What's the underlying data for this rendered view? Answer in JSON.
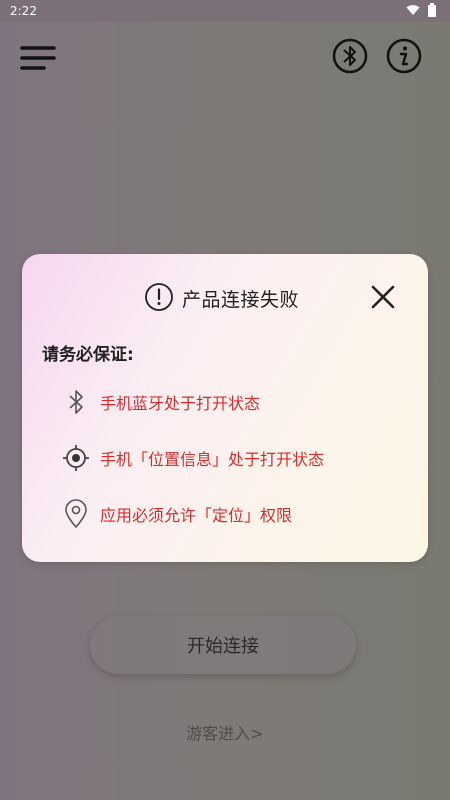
{
  "status_bar": {
    "time": "2:22"
  },
  "header": {
    "menu_icon": "menu-icon",
    "bluetooth_icon": "bluetooth-icon",
    "info_icon": "info-icon"
  },
  "modal": {
    "title": "产品连接失败",
    "subtitle": "请务必保证:",
    "requirements": [
      {
        "icon": "bluetooth-icon",
        "text": "手机蓝牙处于打开状态"
      },
      {
        "icon": "location-target-icon",
        "text": "手机「位置信息」处于打开状态"
      },
      {
        "icon": "location-pin-icon",
        "text": "应用必须允许「定位」权限"
      }
    ]
  },
  "actions": {
    "start_label": "开始连接",
    "guest_label": "游客进入>"
  },
  "colors": {
    "warning_text": "#d52d2d",
    "title_text": "#222222"
  }
}
